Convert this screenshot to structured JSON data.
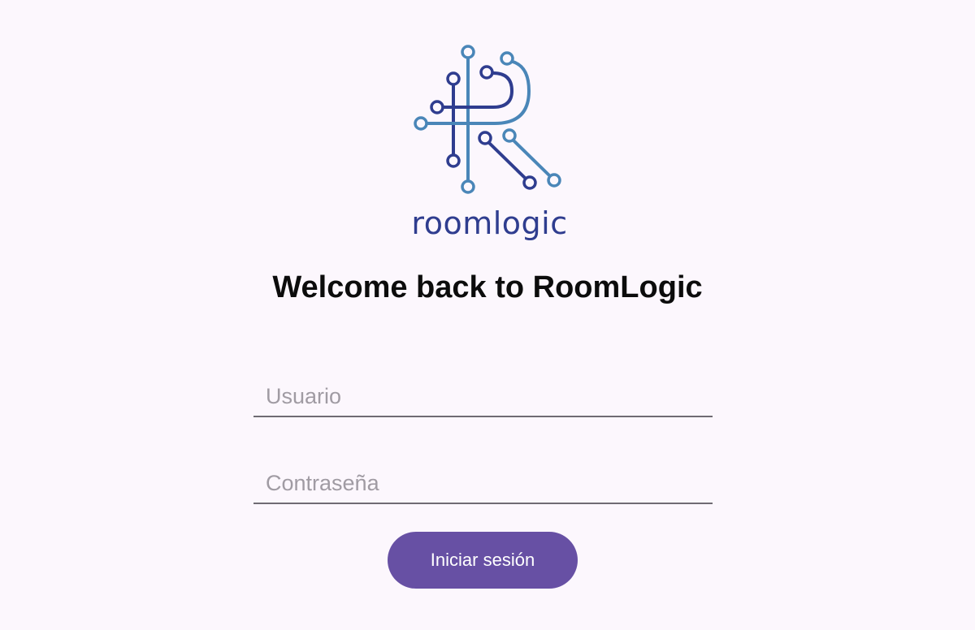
{
  "logo": {
    "wordmark": "roomlogic",
    "icon": "circuit-r-logo-icon",
    "colors": {
      "dark": "#2f3d8f",
      "light": "#4a86b8"
    }
  },
  "page": {
    "title": "Welcome back to RoomLogic"
  },
  "form": {
    "username": {
      "placeholder": "Usuario",
      "value": ""
    },
    "password": {
      "placeholder": "Contraseña",
      "value": ""
    },
    "submit_label": "Iniciar sesión"
  },
  "colors": {
    "background": "#fcf7fd",
    "accent": "#6750a4",
    "field_underline": "#6f6b73"
  }
}
